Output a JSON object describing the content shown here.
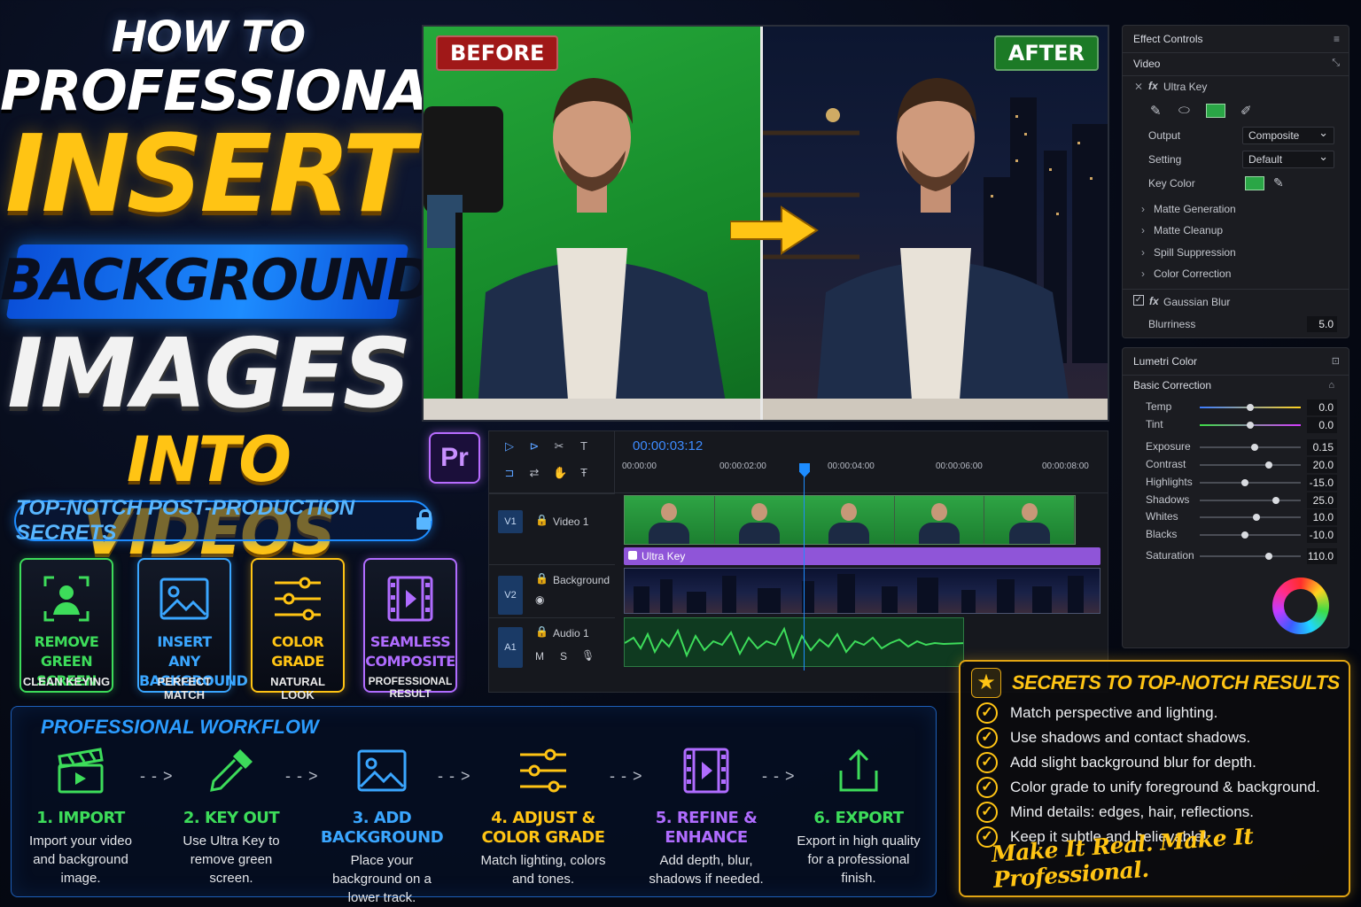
{
  "headline": {
    "line1": "HOW TO",
    "line2": "PROFESSIONALLY",
    "line3": "INSERT",
    "line4": "BACKGROUND",
    "line5": "IMAGES",
    "line6": "INTO VIDEOS"
  },
  "tagline": "TOP-NOTCH POST-PRODUCTION SECRETS",
  "features": [
    {
      "title1": "REMOVE",
      "title2": "GREEN SCREEN",
      "sub": "CLEAN KEYING",
      "icon": "person-frame-icon",
      "color": "#3ddc5a"
    },
    {
      "title1": "INSERT",
      "title2": "ANY BACKGROUND",
      "sub": "PERFECT MATCH",
      "icon": "image-icon",
      "color": "#3aa6ff"
    },
    {
      "title1": "COLOR",
      "title2": "GRADE",
      "sub": "NATURAL LOOK",
      "icon": "sliders-icon",
      "color": "#ffc414"
    },
    {
      "title1": "SEAMLESS",
      "title2": "COMPOSITE",
      "sub": "PROFESSIONAL RESULT",
      "icon": "film-icon",
      "color": "#b06cff"
    }
  ],
  "comparison": {
    "before_label": "BEFORE",
    "after_label": "AFTER"
  },
  "premiere": {
    "logo": "Pr",
    "timecode": "00:00:03:12",
    "ruler": [
      "00:00:00",
      "00:00:02:00",
      "00:00:04:00",
      "00:00:06:00",
      "00:00:08:00"
    ],
    "tracks": {
      "v1": {
        "id": "V1",
        "name": "Video 1"
      },
      "fx": "Ultra Key",
      "v2": {
        "id": "V2",
        "name": "Background"
      },
      "a1": {
        "id": "A1",
        "name": "Audio 1",
        "m": "M",
        "s": "S"
      }
    }
  },
  "effect_controls": {
    "title": "Effect Controls",
    "section": "Video",
    "effect": "Ultra Key",
    "output_label": "Output",
    "output_value": "Composite",
    "setting_label": "Setting",
    "setting_value": "Default",
    "keycolor_label": "Key Color",
    "groups": [
      "Matte Generation",
      "Matte Cleanup",
      "Spill Suppression",
      "Color Correction"
    ],
    "blur_effect": "Gaussian Blur",
    "blur_label": "Blurriness",
    "blur_value": "5.0"
  },
  "lumetri": {
    "title": "Lumetri Color",
    "section": "Basic Correction",
    "rows": [
      {
        "label": "Temp",
        "value": "0.0",
        "pos": 0.5
      },
      {
        "label": "Tint",
        "value": "0.0",
        "pos": 0.5
      },
      {
        "label": "Exposure",
        "value": "0.15",
        "pos": 0.54
      },
      {
        "label": "Contrast",
        "value": "20.0",
        "pos": 0.68
      },
      {
        "label": "Highlights",
        "value": "-15.0",
        "pos": 0.45
      },
      {
        "label": "Shadows",
        "value": "25.0",
        "pos": 0.75
      },
      {
        "label": "Whites",
        "value": "10.0",
        "pos": 0.56
      },
      {
        "label": "Blacks",
        "value": "-10.0",
        "pos": 0.45
      },
      {
        "label": "Saturation",
        "value": "110.0",
        "pos": 0.68
      }
    ]
  },
  "workflow": {
    "title": "PROFESSIONAL WORKFLOW",
    "steps": [
      {
        "title": "1. IMPORT",
        "desc": "Import your video and background image.",
        "icon": "clapperboard-icon",
        "color": "#3ddc5a"
      },
      {
        "title": "2. KEY OUT",
        "desc": "Use Ultra Key to remove green screen.",
        "icon": "eyedropper-icon",
        "color": "#3ddc5a"
      },
      {
        "title": "3. ADD BACKGROUND",
        "desc": "Place your background on a lower track.",
        "icon": "image-icon",
        "color": "#3aa6ff"
      },
      {
        "title": "4. ADJUST & COLOR GRADE",
        "desc": "Match lighting, colors and tones.",
        "icon": "sliders-icon",
        "color": "#ffc414"
      },
      {
        "title": "5. REFINE & ENHANCE",
        "desc": "Add depth, blur, shadows if needed.",
        "icon": "film-icon",
        "color": "#b06cff"
      },
      {
        "title": "6. EXPORT",
        "desc": "Export in high quality for a professional finish.",
        "icon": "share-icon",
        "color": "#3ddc5a"
      }
    ],
    "connector": "- - >"
  },
  "secrets": {
    "title": "SECRETS TO TOP-NOTCH RESULTS",
    "items": [
      "Match perspective and lighting.",
      "Use shadows and contact shadows.",
      "Add slight background blur for depth.",
      "Color grade to unify foreground & background.",
      "Mind details: edges, hair, reflections.",
      "Keep it subtle and believable!"
    ],
    "slogan": "Make It Real. Make It Professional."
  }
}
